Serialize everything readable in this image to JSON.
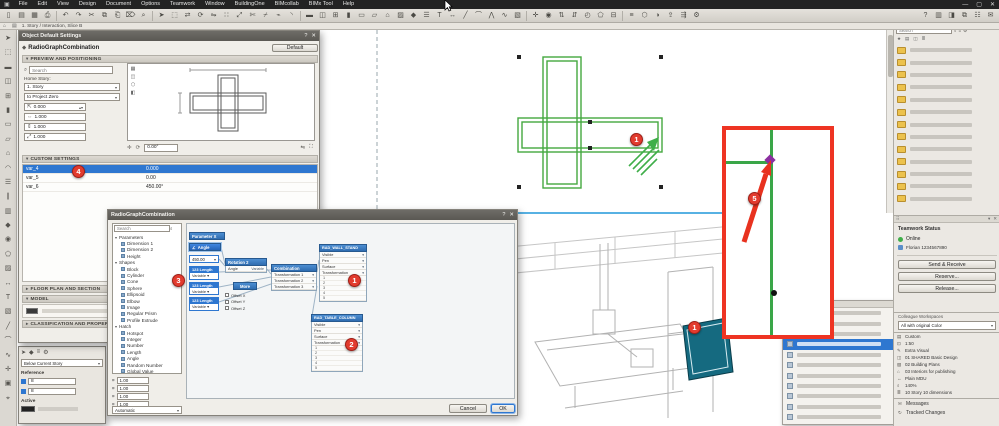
{
  "window": {
    "app_icon": "▣",
    "controls": {
      "minimize": "—",
      "maximize": "▢",
      "close": "✕"
    }
  },
  "menubar": {
    "items": [
      "File",
      "Edit",
      "View",
      "Design",
      "Document",
      "Options",
      "Teamwork",
      "Window",
      "BuildingOne",
      "BIMcollab",
      "BIMx Tool",
      "Help"
    ]
  },
  "toolbar": {
    "icons": [
      {
        "n": "new",
        "g": "▯"
      },
      {
        "n": "open",
        "g": "▤"
      },
      {
        "n": "save",
        "g": "▦"
      },
      {
        "n": "print",
        "g": "⎙"
      },
      {
        "n": "undo",
        "g": "↶"
      },
      {
        "n": "redo",
        "g": "↷"
      },
      {
        "n": "cut",
        "g": "✂"
      },
      {
        "n": "copy",
        "g": "⧉"
      },
      {
        "n": "paste",
        "g": "⎗"
      },
      {
        "n": "delete",
        "g": "⌦"
      },
      {
        "n": "search",
        "g": "⌕"
      },
      {
        "n": "arrow",
        "g": "➤"
      },
      {
        "n": "marquee",
        "g": "⬚"
      },
      {
        "n": "drag",
        "g": "⇄"
      },
      {
        "n": "rotate",
        "g": "⟳"
      },
      {
        "n": "mirror",
        "g": "⇋"
      },
      {
        "n": "multiply",
        "g": "∷"
      },
      {
        "n": "stretch",
        "g": "⤢"
      },
      {
        "n": "trim",
        "g": "✄"
      },
      {
        "n": "split",
        "g": "⌿"
      },
      {
        "n": "adjust",
        "g": "⌁"
      },
      {
        "n": "fillet",
        "g": "◝"
      },
      {
        "n": "wall",
        "g": "▬"
      },
      {
        "n": "door",
        "g": "◫"
      },
      {
        "n": "window",
        "g": "⊞"
      },
      {
        "n": "column",
        "g": "▮"
      },
      {
        "n": "beam",
        "g": "▭"
      },
      {
        "n": "slab",
        "g": "▱"
      },
      {
        "n": "roof",
        "g": "⌂"
      },
      {
        "n": "mesh",
        "g": "▨"
      },
      {
        "n": "object",
        "g": "◆"
      },
      {
        "n": "stair",
        "g": "☰"
      },
      {
        "n": "text",
        "g": "T"
      },
      {
        "n": "dimension",
        "g": "↔"
      },
      {
        "n": "line",
        "g": "╱"
      },
      {
        "n": "arc",
        "g": "⌒"
      },
      {
        "n": "polyline",
        "g": "⋀"
      },
      {
        "n": "spline",
        "g": "∿"
      },
      {
        "n": "fill",
        "g": "▧"
      },
      {
        "n": "hotspot",
        "g": "✛"
      },
      {
        "n": "camera",
        "g": "◉"
      },
      {
        "n": "section",
        "g": "⇅"
      },
      {
        "n": "elevation",
        "g": "⇵"
      },
      {
        "n": "detail",
        "g": "◴"
      },
      {
        "n": "zone",
        "g": "⬠"
      },
      {
        "n": "grid",
        "g": "⊟"
      },
      {
        "n": "layers",
        "g": "≡"
      },
      {
        "n": "view-3d",
        "g": "⬡"
      },
      {
        "n": "render",
        "g": "◑"
      },
      {
        "n": "publish",
        "g": "⇪"
      },
      {
        "n": "teamwork-sync",
        "g": "⇶"
      },
      {
        "n": "settings",
        "g": "⚙"
      }
    ],
    "right_icons": [
      {
        "n": "help",
        "g": "?"
      },
      {
        "n": "panels",
        "g": "▥"
      },
      {
        "n": "navigator",
        "g": "◨"
      },
      {
        "n": "organizer",
        "g": "⧉"
      },
      {
        "n": "quick-options",
        "g": "☷"
      },
      {
        "n": "messages",
        "g": "✉"
      }
    ]
  },
  "viewbar": {
    "tab_label": "1. Story / Interaction, Slice B"
  },
  "toolbox": {
    "icons": [
      {
        "n": "select-arrow",
        "g": "➤"
      },
      {
        "n": "marquee",
        "g": "⬚"
      },
      {
        "n": "wall",
        "g": "▬"
      },
      {
        "n": "door",
        "g": "◫"
      },
      {
        "n": "window",
        "g": "⊞"
      },
      {
        "n": "column",
        "g": "▮"
      },
      {
        "n": "beam",
        "g": "▭"
      },
      {
        "n": "slab",
        "g": "▱"
      },
      {
        "n": "roof",
        "g": "⌂"
      },
      {
        "n": "shell",
        "g": "◠"
      },
      {
        "n": "stair",
        "g": "☰"
      },
      {
        "n": "railing",
        "g": "∥"
      },
      {
        "n": "curtain-wall",
        "g": "▥"
      },
      {
        "n": "object",
        "g": "◆"
      },
      {
        "n": "lamp",
        "g": "◉"
      },
      {
        "n": "zone",
        "g": "⬠"
      },
      {
        "n": "mesh",
        "g": "▨"
      },
      {
        "n": "dimension",
        "g": "↔"
      },
      {
        "n": "text",
        "g": "T"
      },
      {
        "n": "fill",
        "g": "▧"
      },
      {
        "n": "line",
        "g": "╱"
      },
      {
        "n": "arc",
        "g": "⌒"
      },
      {
        "n": "spline",
        "g": "∿"
      },
      {
        "n": "hotspot",
        "g": "✛"
      },
      {
        "n": "figure",
        "g": "▣"
      },
      {
        "n": "camera",
        "g": "⌖"
      }
    ]
  },
  "plan_view": {
    "badge": "1"
  },
  "view3d": {
    "badge": "1"
  },
  "inset": {
    "badge": "5"
  },
  "settings_dialog": {
    "title": "Object Default Settings",
    "help_icon": "?",
    "close_icon": "✕",
    "object_name": "RadioGraphCombination",
    "default_button": "Default",
    "sections": {
      "preview": "PREVIEW AND POSITIONING",
      "custom": "CUSTOM SETTINGS",
      "floorplan": "FLOOR PLAN AND SECTION",
      "model": "MODEL",
      "classification": "CLASSIFICATION AND PROPERTIES"
    },
    "search_placeholder": "Search",
    "home_story_label": "Home Story:",
    "home_story_value": "1. Story",
    "anchor_value": "to Project Zero",
    "elevation_value": "0.000",
    "size_fields": [
      "1.000",
      "1.000",
      "1.000"
    ],
    "rotation_value": "0.00°",
    "params": {
      "rows": [
        {
          "name": "var_4",
          "value": "0.000",
          "selected": true
        },
        {
          "name": "var_5",
          "value": "0.00",
          "selected": false
        },
        {
          "name": "var_6",
          "value": "450.00°",
          "selected": false
        }
      ]
    },
    "badge": "4"
  },
  "infobox": {
    "story_dropdown": "Below Current Story",
    "reference_label": "Reference",
    "reference_values": [
      "8",
      "8"
    ],
    "active_label": "Active"
  },
  "node_dialog": {
    "title": "RadioGraphCombination",
    "help_icon": "?",
    "close_icon": "✕",
    "search_placeholder": "Search",
    "tree": [
      {
        "l": "Parameters",
        "d": 0,
        "g": true
      },
      {
        "l": "Dimension 1",
        "d": 1
      },
      {
        "l": "Dimension 2",
        "d": 1
      },
      {
        "l": "Height",
        "d": 1
      },
      {
        "l": "Shapes",
        "d": 0,
        "g": true
      },
      {
        "l": "Block",
        "d": 1
      },
      {
        "l": "Cylinder",
        "d": 1
      },
      {
        "l": "Cone",
        "d": 1
      },
      {
        "l": "Sphere",
        "d": 1
      },
      {
        "l": "Ellipsoid",
        "d": 1
      },
      {
        "l": "Elbow",
        "d": 1
      },
      {
        "l": "Image",
        "d": 1
      },
      {
        "l": "Regular Prism",
        "d": 1
      },
      {
        "l": "Profile Extrude",
        "d": 1
      },
      {
        "l": "Hatch",
        "d": 0,
        "g": true
      },
      {
        "l": "Hotspot",
        "d": 1
      },
      {
        "l": "Integer",
        "d": 1
      },
      {
        "l": "Number",
        "d": 1
      },
      {
        "l": "Length",
        "d": 1
      },
      {
        "l": "Angle",
        "d": 1
      },
      {
        "l": "Random Number",
        "d": 1
      },
      {
        "l": "Global Value",
        "d": 1
      }
    ],
    "bottom_fields": [
      "1.00",
      "1.00",
      "1.00",
      "1.00"
    ],
    "mode_dropdown": "Automatic",
    "nodes": {
      "parameter": {
        "title": "Parameter X"
      },
      "angle": {
        "title": "Angle",
        "glyph": "∠"
      },
      "value_field": "450.00",
      "lengths": [
        {
          "title": "123 Length",
          "value": "Variable"
        },
        {
          "title": "123 Length",
          "value": "Variable"
        },
        {
          "title": "123 Length",
          "value": "Variable"
        }
      ],
      "rotation": {
        "title": "Rotation 2",
        "row_label": "Angle",
        "row_value": "Variable",
        "more_button": "More",
        "offsets": [
          "Offset X",
          "Offset Y",
          "Offset Z"
        ]
      },
      "combination": {
        "title": "Combination",
        "rows": [
          "Transformation 1",
          "Transformation 2",
          "Transformation 3"
        ]
      },
      "wall_stand": {
        "title": "RAD_WALL_STAND",
        "props": [
          "Visible",
          "Pen",
          "Surface",
          "Transformation"
        ],
        "ports": [
          "1",
          "2",
          "3",
          "4",
          "5"
        ],
        "badge": "1"
      },
      "table_column": {
        "title": "RAD_TABLE_COLUMN",
        "props": [
          "Visible",
          "Pen",
          "Surface",
          "Transformation"
        ],
        "ports": [
          "1",
          "2",
          "3",
          "4",
          "5"
        ],
        "badge": "2"
      }
    },
    "stack_badge": "3",
    "cancel_button": "Cancel",
    "ok_button": "OK"
  },
  "favorites": {
    "search_placeholder": "Search",
    "folder_count": 13
  },
  "teamwork": {
    "title": "Teamwork Status",
    "status": "Online",
    "user": "Florian 1234567890",
    "send_receive_button": "Send & Receive",
    "reserve_button": "Reserve...",
    "release_button": "Release...",
    "workspaces_label": "Colleague Workspaces",
    "workspaces_value": "All with original Color"
  },
  "quick_options": {
    "items": [
      {
        "icon": "layer-combination",
        "g": "▤",
        "label": "Custom"
      },
      {
        "icon": "scale",
        "g": "⊡",
        "label": "1:50"
      },
      {
        "icon": "pen-set",
        "g": "✎",
        "label": "Extra Visual"
      },
      {
        "icon": "model-view-options",
        "g": "◫",
        "label": "01 SHARED Basic Design"
      },
      {
        "icon": "graphic-override",
        "g": "▧",
        "label": "02 Building Plans"
      },
      {
        "icon": "renovation-filter",
        "g": "⌂",
        "label": "03 Interiors for publishing"
      },
      {
        "icon": "dimension-style",
        "g": "↔",
        "label": "Plain MDU"
      },
      {
        "icon": "zoom-level",
        "g": "⌕",
        "label": "140%"
      },
      {
        "icon": "story",
        "g": "≣",
        "label": "10 Story 10 dimensions"
      }
    ]
  },
  "bottom_right": {
    "items": [
      {
        "icon": "messages",
        "g": "✉",
        "label": "Messages"
      },
      {
        "icon": "tracked-changes",
        "g": "↻",
        "label": "Tracked Changes"
      }
    ]
  },
  "mid_palette": {
    "row_count": 11
  },
  "colors": {
    "accent_blue": "#2e77d0",
    "badge_red": "#e23b2e",
    "inset_red": "#ee3423",
    "drawing_green": "#44a83f",
    "teal": "#156a80",
    "purple": "#8b2fa0",
    "online_green": "#3fae49"
  }
}
